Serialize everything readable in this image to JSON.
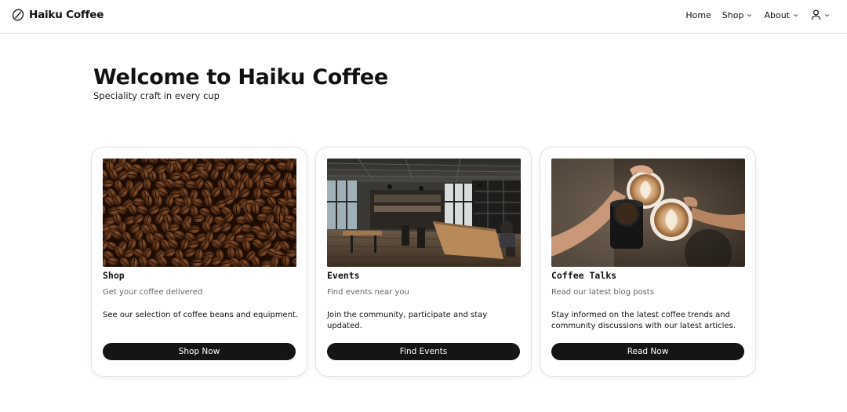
{
  "nav": {
    "brand_name": "Haiku Coffee",
    "links": {
      "home": "Home",
      "shop": "Shop",
      "about": "About"
    }
  },
  "hero": {
    "title": "Welcome to Haiku Coffee",
    "subtitle": "Speciality craft in every cup"
  },
  "cards": [
    {
      "title": "Shop",
      "subtitle": "Get your coffee delivered",
      "text": "See our selection of coffee beans and equipment.",
      "button": "Shop Now",
      "image": "coffee-beans-photo"
    },
    {
      "title": "Events",
      "subtitle": "Find events near you",
      "text": "Join the community, participate and stay updated.",
      "button": "Find Events",
      "image": "cafe-interior-photo"
    },
    {
      "title": "Coffee Talks",
      "subtitle": "Read our latest blog posts",
      "text": "Stay informed on the latest coffee trends and community discussions with our latest articles.",
      "button": "Read Now",
      "image": "latte-cheers-photo"
    }
  ],
  "colors": {
    "button_bg": "#151515",
    "text": "#111111",
    "muted_text": "#666666",
    "border": "#e3e3e3"
  }
}
